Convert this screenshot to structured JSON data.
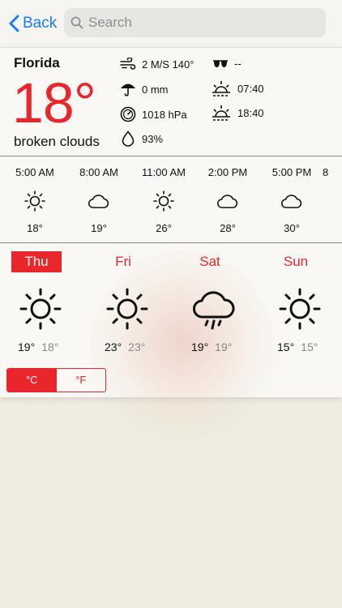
{
  "nav": {
    "back_label": "Back",
    "search_placeholder": "Search"
  },
  "current": {
    "city": "Florida",
    "temperature": "18°",
    "condition": "broken clouds",
    "wind": "2 M/S 140°",
    "uv": "--",
    "precipitation": "0 mm",
    "sunrise": "07:40",
    "pressure": "1018 hPa",
    "sunset": "18:40",
    "humidity": "93%"
  },
  "hourly": [
    {
      "time": "5:00 AM",
      "icon": "sun-icon",
      "temp": "18°"
    },
    {
      "time": "8:00 AM",
      "icon": "cloud-icon",
      "temp": "19°"
    },
    {
      "time": "11:00 AM",
      "icon": "sun-icon",
      "temp": "26°"
    },
    {
      "time": "2:00 PM",
      "icon": "cloud-icon",
      "temp": "28°"
    },
    {
      "time": "5:00 PM",
      "icon": "cloud-icon",
      "temp": "30°"
    },
    {
      "time": "8",
      "icon": "",
      "temp": ""
    }
  ],
  "daily": [
    {
      "day": "Thu",
      "icon": "sun-icon",
      "high": "19°",
      "low": "18°",
      "selected": true
    },
    {
      "day": "Fri",
      "icon": "sun-icon",
      "high": "23°",
      "low": "23°",
      "selected": false
    },
    {
      "day": "Sat",
      "icon": "rain-cloud-icon",
      "high": "19°",
      "low": "19°",
      "selected": false
    },
    {
      "day": "Sun",
      "icon": "sun-icon",
      "high": "15°",
      "low": "15°",
      "selected": false
    }
  ],
  "units": {
    "celsius": "°C",
    "fahrenheit": "°F",
    "active": "celsius"
  },
  "colors": {
    "accent": "#e8262b",
    "link": "#1a7bf2"
  }
}
